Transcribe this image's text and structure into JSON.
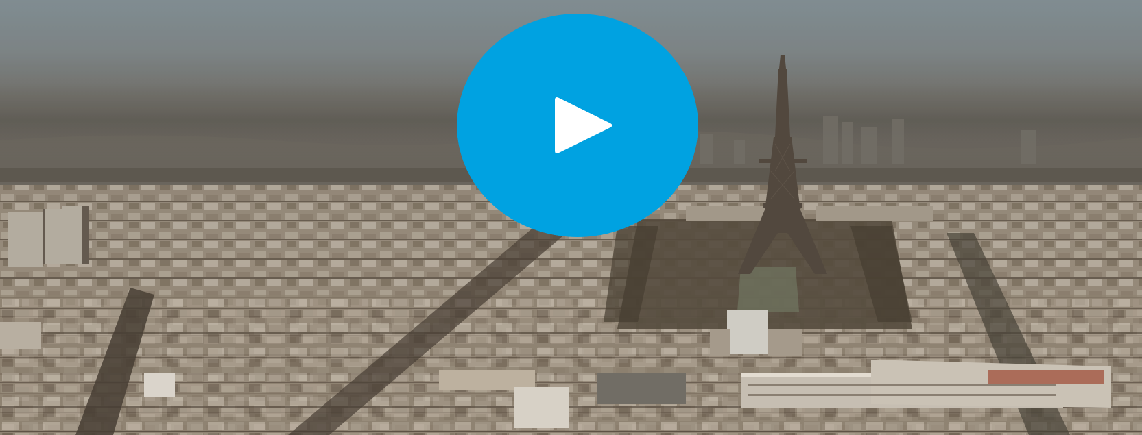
{
  "player": {
    "play_icon": "play-icon",
    "play_button_color": "#00a2e1",
    "play_icon_color": "#ffffff"
  },
  "poster": {
    "sky_top_color": "#7d8c94",
    "haze_color": "#8a8a84",
    "city_color": "#9c8f7f",
    "shadow_color": "#4a4036"
  }
}
